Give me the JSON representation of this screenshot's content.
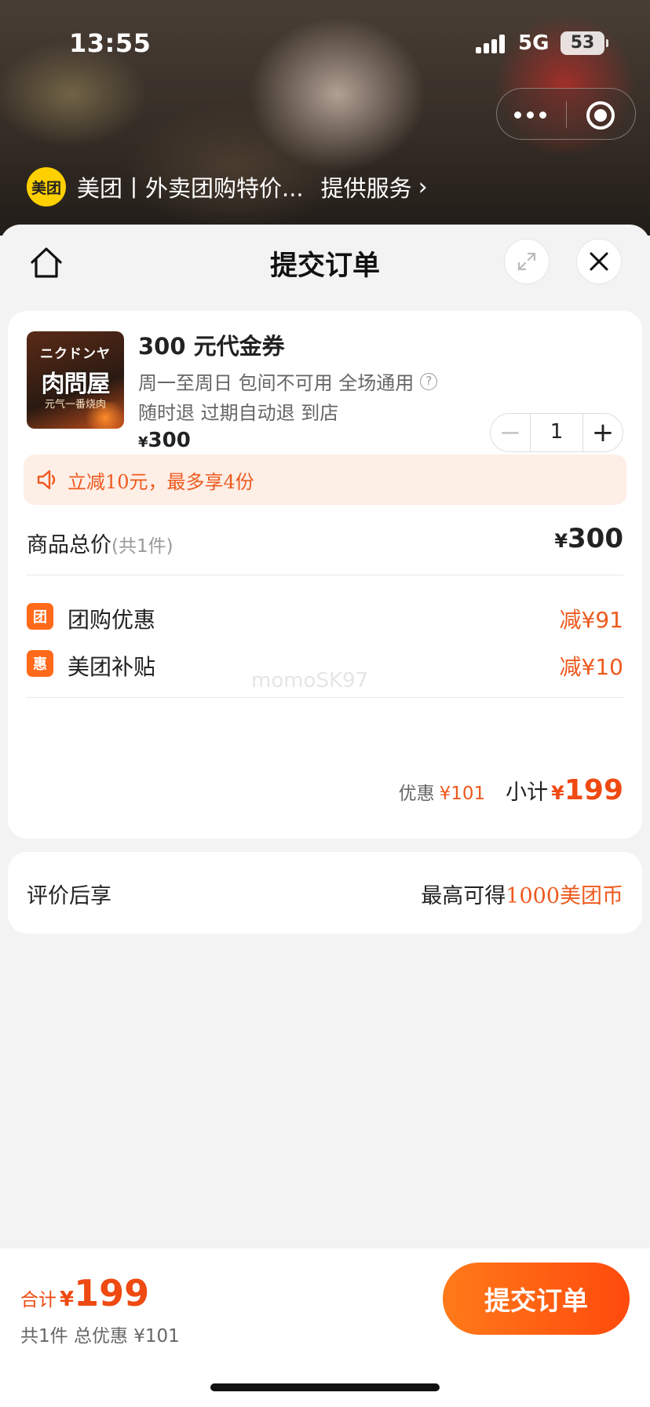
{
  "status_bar": {
    "time": "13:55",
    "network": "5G",
    "battery": "53"
  },
  "provider": {
    "logo_text": "美团",
    "name": "美团丨外卖团购特价...",
    "service_label": "提供服务"
  },
  "nav": {
    "title": "提交订单"
  },
  "product": {
    "image_text_top": "ニクドンヤ",
    "image_text_main": "肉問屋",
    "image_text_bottom": "元气一番烧肉",
    "title": "300 元代金券",
    "desc_line1": "周一至周日 包间不可用 全场通用",
    "desc_line2": "随时退 过期自动退 到店",
    "price_symbol": "¥",
    "price": "300",
    "quantity": "1",
    "minus": "−",
    "plus": "+"
  },
  "promo": {
    "text": "立减10元，最多享4份"
  },
  "totals": {
    "goods_label": "商品总价",
    "goods_count": "(共1件)",
    "goods_symbol": "¥",
    "goods_value": "300"
  },
  "discounts": [
    {
      "tag": "团",
      "label": "团购优惠",
      "amount": "减¥91"
    },
    {
      "tag": "惠",
      "label": "美团补贴",
      "amount": "减¥10"
    }
  ],
  "watermark": "momoSK97",
  "subtotal": {
    "discount_label": "优惠",
    "discount_value": "¥101",
    "label": "小计",
    "symbol": "¥",
    "value": "199"
  },
  "review": {
    "label": "评价后享",
    "prefix": "最高可得",
    "highlight": "1000美团币"
  },
  "bottom": {
    "total_label": "合计",
    "symbol": "¥",
    "total_value": "199",
    "meta": "共1件 总优惠 ¥101",
    "submit_label": "提交订单"
  },
  "colors": {
    "accent": "#ee5a1e",
    "button_start": "#ff7a1a",
    "button_end": "#ff4a0c",
    "promo_bg": "#fdeee6"
  }
}
